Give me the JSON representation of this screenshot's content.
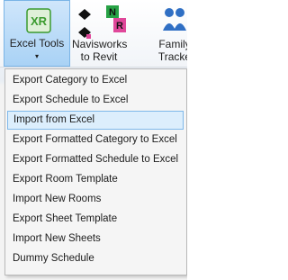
{
  "ribbon": {
    "excel_tools": {
      "label": "Excel Tools",
      "icon_letters": "XR",
      "arrow": "▾"
    },
    "navisworks": {
      "label_line1": "Navisworks",
      "label_line2": "to Revit",
      "icon_letters_top": "N",
      "icon_letters_bottom": "R"
    },
    "family": {
      "label_line1": "Family",
      "label_line2": "Tracke"
    }
  },
  "menu": {
    "items": [
      {
        "label": "Export Category to Excel"
      },
      {
        "label": "Export Schedule to Excel"
      },
      {
        "label": "Import from Excel",
        "selected": true
      },
      {
        "label": "Export Formatted Category to Excel"
      },
      {
        "label": "Export Formatted Schedule to Excel"
      },
      {
        "label": "Export Room Template"
      },
      {
        "label": "Import New Rooms"
      },
      {
        "label": "Export Sheet Template"
      },
      {
        "label": "Import New Sheets"
      },
      {
        "label": "Dummy Schedule"
      }
    ]
  },
  "colors": {
    "xr_green": "#3a9a2e",
    "navis_green": "#27a245",
    "navis_pink": "#e0479a",
    "family_blue": "#2f6fc4"
  }
}
